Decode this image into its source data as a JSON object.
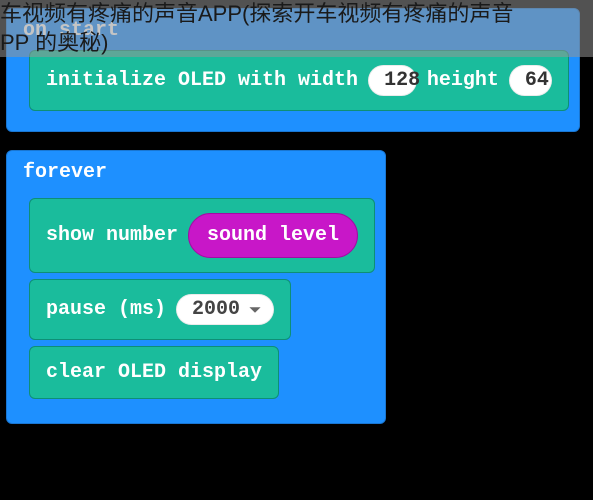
{
  "overlay": {
    "line": "车视频有疼痛的声音APP(探索开车视频有疼痛的声音\nPP 的奥秘)"
  },
  "blocks": {
    "on_start": {
      "label": "on start",
      "init_oled_prefix": "initialize OLED with width",
      "init_oled_width": "128",
      "init_oled_mid": "height",
      "init_oled_height": "64"
    },
    "forever": {
      "label": "forever",
      "show_number_label": "show number",
      "sound_level_label": "sound level",
      "pause_label": "pause (ms)",
      "pause_value": "2000",
      "clear_label": "clear OLED display"
    }
  }
}
